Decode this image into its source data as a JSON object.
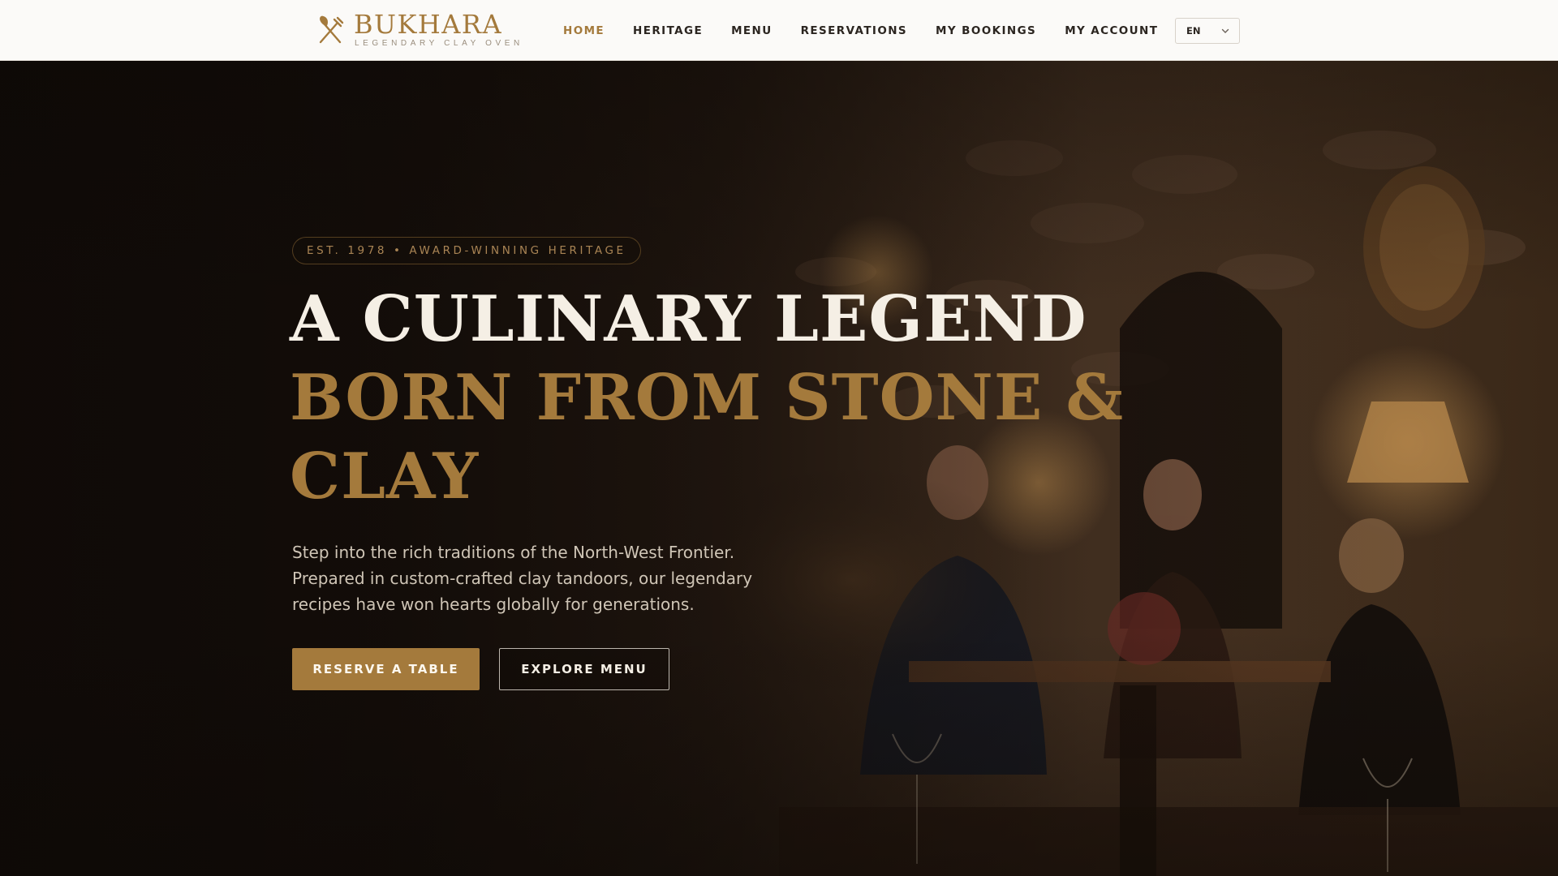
{
  "brand": {
    "name": "BUKHARA",
    "tagline": "LEGENDARY CLAY OVEN",
    "icon": "crossed-utensils-icon"
  },
  "nav": {
    "items": [
      {
        "label": "HOME",
        "active": true
      },
      {
        "label": "HERITAGE",
        "active": false
      },
      {
        "label": "MENU",
        "active": false
      },
      {
        "label": "RESERVATIONS",
        "active": false
      },
      {
        "label": "MY BOOKINGS",
        "active": false
      },
      {
        "label": "MY ACCOUNT",
        "active": false
      }
    ]
  },
  "language": {
    "selected": "EN",
    "icon": "chevron-down-icon"
  },
  "hero": {
    "badge": "EST. 1978 • AWARD-WINNING HERITAGE",
    "headline": {
      "line1": "A CULINARY LEGEND",
      "line2": "BORN FROM STONE &",
      "line3": "CLAY"
    },
    "intro": "Step into the rich traditions of the North-West Frontier. Prepared in custom-crafted clay tandoors, our legendary recipes have won hearts globally for generations.",
    "primary_button": "RESERVE A TABLE",
    "secondary_button": "EXPLORE MENU"
  },
  "colors": {
    "accent": "#a47a3c",
    "header_bg": "#fbfaf8",
    "hero_bg": "#120d09",
    "headline_light": "#f5efe5"
  }
}
